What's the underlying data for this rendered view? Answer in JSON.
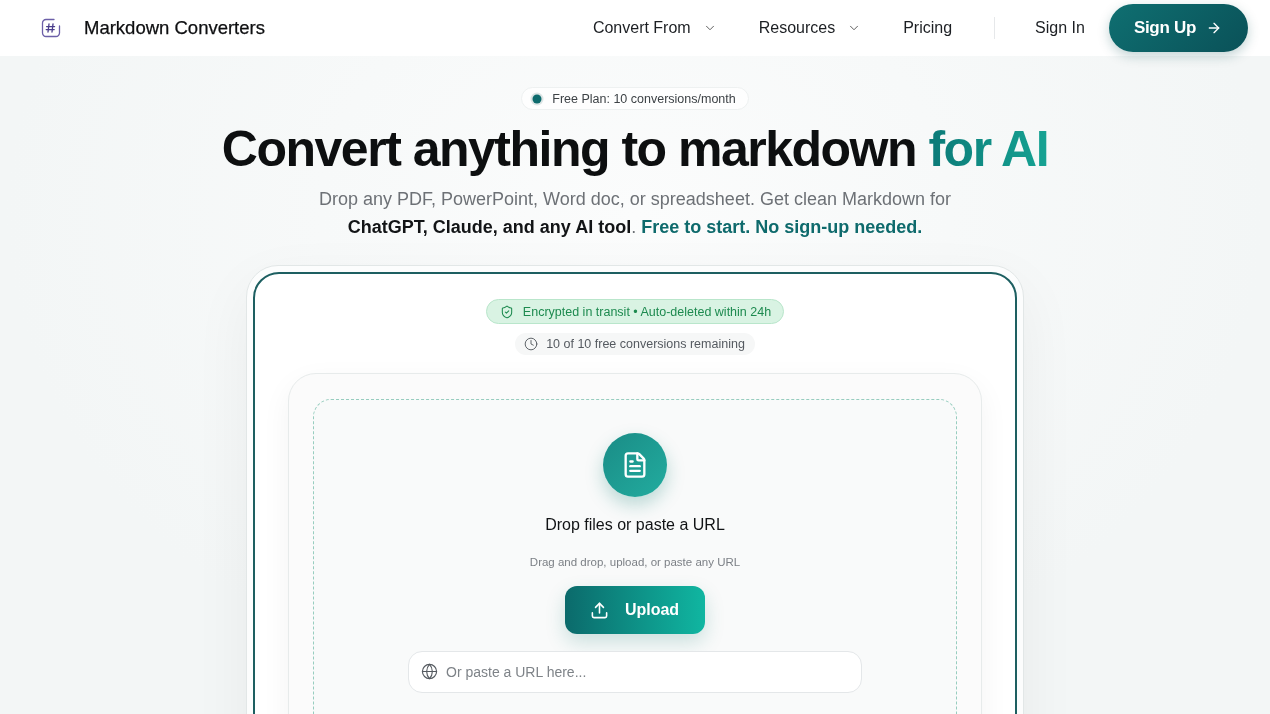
{
  "header": {
    "brand": "Markdown Converters",
    "nav": [
      {
        "label": "Convert From",
        "dropdown": true
      },
      {
        "label": "Resources",
        "dropdown": true
      },
      {
        "label": "Pricing",
        "dropdown": false
      }
    ],
    "sign_in": "Sign In",
    "sign_up": "Sign Up"
  },
  "hero": {
    "badge": "Free Plan: 10 conversions/month",
    "title": "Convert anything to markdown",
    "title_accent": "for AI",
    "subtitle": "Drop any PDF, PowerPoint, Word doc, or spreadsheet. Get clean Markdown for **ChatGPT, Claude, and any AI tool**.",
    "subtitle_highlight": "Free to start. No sign-up needed."
  },
  "converter": {
    "security_note": "Encrypted in transit • Auto-deleted within 24h",
    "quota": "10 of 10 free conversions remaining",
    "dropzone": {
      "title": "Drop files or paste a URL",
      "hint": "Drag and drop, upload, or paste any URL",
      "upload_button": "Upload",
      "url_field": {
        "placeholder": "Or paste a URL here..."
      }
    }
  }
}
